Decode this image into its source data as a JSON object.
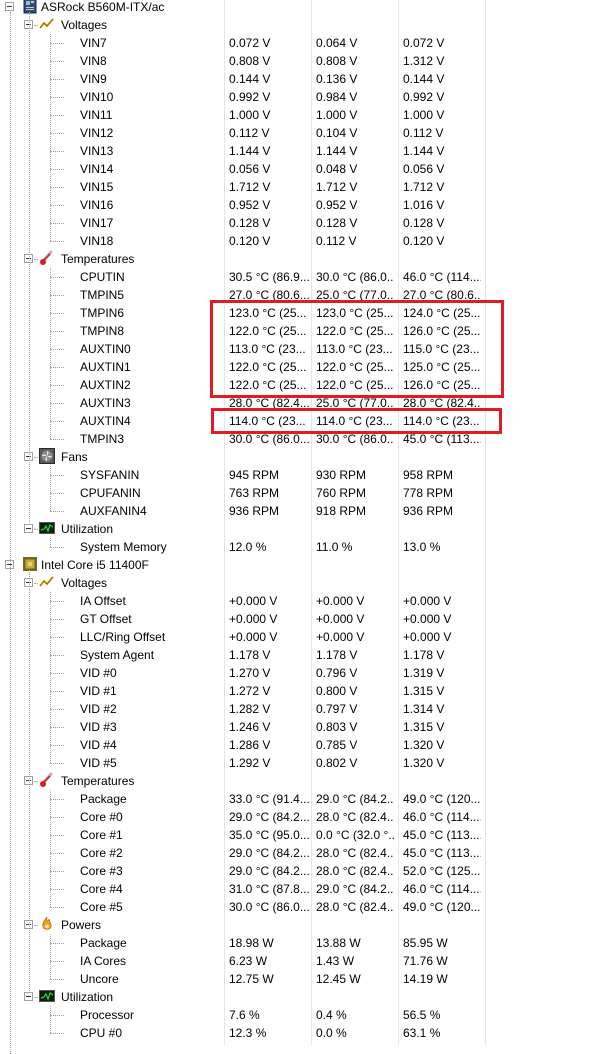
{
  "colors": {
    "highlight": "#e01b24",
    "tree_line": "#a0a0a0"
  },
  "tree": [
    {
      "type": "device",
      "label": "ASRock B560M-ITX/ac",
      "icon": "motherboard-icon",
      "groups": [
        {
          "label": "Voltages",
          "icon": "voltage-icon",
          "sensors": [
            {
              "name": "VIN7",
              "v": [
                "0.072 V",
                "0.064 V",
                "0.072 V"
              ]
            },
            {
              "name": "VIN8",
              "v": [
                "0.808 V",
                "0.808 V",
                "1.312 V"
              ]
            },
            {
              "name": "VIN9",
              "v": [
                "0.144 V",
                "0.136 V",
                "0.144 V"
              ]
            },
            {
              "name": "VIN10",
              "v": [
                "0.992 V",
                "0.984 V",
                "0.992 V"
              ]
            },
            {
              "name": "VIN11",
              "v": [
                "1.000 V",
                "1.000 V",
                "1.000 V"
              ]
            },
            {
              "name": "VIN12",
              "v": [
                "0.112 V",
                "0.104 V",
                "0.112 V"
              ]
            },
            {
              "name": "VIN13",
              "v": [
                "1.144 V",
                "1.144 V",
                "1.144 V"
              ]
            },
            {
              "name": "VIN14",
              "v": [
                "0.056 V",
                "0.048 V",
                "0.056 V"
              ]
            },
            {
              "name": "VIN15",
              "v": [
                "1.712 V",
                "1.712 V",
                "1.712 V"
              ]
            },
            {
              "name": "VIN16",
              "v": [
                "0.952 V",
                "0.952 V",
                "1.016 V"
              ]
            },
            {
              "name": "VIN17",
              "v": [
                "0.128 V",
                "0.128 V",
                "0.128 V"
              ]
            },
            {
              "name": "VIN18",
              "v": [
                "0.120 V",
                "0.112 V",
                "0.120 V"
              ]
            }
          ]
        },
        {
          "label": "Temperatures",
          "icon": "thermometer-icon",
          "sensors": [
            {
              "name": "CPUTIN",
              "v": [
                "30.5 °C  (86.9...",
                "30.0 °C  (86.0...",
                "46.0 °C  (114...."
              ]
            },
            {
              "name": "TMPIN5",
              "v": [
                "27.0 °C  (80.6...",
                "25.0 °C  (77.0...",
                "27.0 °C  (80.6..."
              ]
            },
            {
              "name": "TMPIN6",
              "v": [
                "123.0 °C  (25...",
                "123.0 °C  (25...",
                "124.0 °C  (25..."
              ]
            },
            {
              "name": "TMPIN8",
              "v": [
                "122.0 °C  (25...",
                "122.0 °C  (25...",
                "126.0 °C  (25..."
              ]
            },
            {
              "name": "AUXTIN0",
              "v": [
                "113.0 °C  (23...",
                "113.0 °C  (23...",
                "115.0 °C  (23..."
              ]
            },
            {
              "name": "AUXTIN1",
              "v": [
                "122.0 °C  (25...",
                "122.0 °C  (25...",
                "125.0 °C  (25..."
              ]
            },
            {
              "name": "AUXTIN2",
              "v": [
                "122.0 °C  (25...",
                "122.0 °C  (25...",
                "126.0 °C  (25..."
              ]
            },
            {
              "name": "AUXTIN3",
              "v": [
                "28.0 °C  (82.4...",
                "25.0 °C  (77.0...",
                "28.0 °C  (82.4..."
              ]
            },
            {
              "name": "AUXTIN4",
              "v": [
                "114.0 °C  (23...",
                "114.0 °C  (23...",
                "114.0 °C  (23..."
              ]
            },
            {
              "name": "TMPIN3",
              "v": [
                "30.0 °C  (86.0...",
                "30.0 °C  (86.0...",
                "45.0 °C  (113...."
              ]
            }
          ]
        },
        {
          "label": "Fans",
          "icon": "fan-icon",
          "sensors": [
            {
              "name": "SYSFANIN",
              "v": [
                "945 RPM",
                "930 RPM",
                "958 RPM"
              ]
            },
            {
              "name": "CPUFANIN",
              "v": [
                "763 RPM",
                "760 RPM",
                "778 RPM"
              ]
            },
            {
              "name": "AUXFANIN4",
              "v": [
                "936 RPM",
                "918 RPM",
                "936 RPM"
              ]
            }
          ]
        },
        {
          "label": "Utilization",
          "icon": "utilization-icon",
          "sensors": [
            {
              "name": "System Memory",
              "v": [
                "12.0 %",
                "11.0 %",
                "13.0 %"
              ]
            }
          ]
        }
      ]
    },
    {
      "type": "device",
      "label": "Intel Core i5 11400F",
      "icon": "cpu-icon",
      "groups": [
        {
          "label": "Voltages",
          "icon": "voltage-icon",
          "sensors": [
            {
              "name": "IA Offset",
              "v": [
                "+0.000 V",
                "+0.000 V",
                "+0.000 V"
              ]
            },
            {
              "name": "GT Offset",
              "v": [
                "+0.000 V",
                "+0.000 V",
                "+0.000 V"
              ]
            },
            {
              "name": "LLC/Ring Offset",
              "v": [
                "+0.000 V",
                "+0.000 V",
                "+0.000 V"
              ]
            },
            {
              "name": "System Agent",
              "v": [
                "1.178 V",
                "1.178 V",
                "1.178 V"
              ]
            },
            {
              "name": "VID #0",
              "v": [
                "1.270 V",
                "0.796 V",
                "1.319 V"
              ]
            },
            {
              "name": "VID #1",
              "v": [
                "1.272 V",
                "0.800 V",
                "1.315 V"
              ]
            },
            {
              "name": "VID #2",
              "v": [
                "1.282 V",
                "0.797 V",
                "1.314 V"
              ]
            },
            {
              "name": "VID #3",
              "v": [
                "1.246 V",
                "0.803 V",
                "1.315 V"
              ]
            },
            {
              "name": "VID #4",
              "v": [
                "1.286 V",
                "0.785 V",
                "1.320 V"
              ]
            },
            {
              "name": "VID #5",
              "v": [
                "1.292 V",
                "0.802 V",
                "1.320 V"
              ]
            }
          ]
        },
        {
          "label": "Temperatures",
          "icon": "thermometer-icon",
          "sensors": [
            {
              "name": "Package",
              "v": [
                "33.0 °C  (91.4...",
                "29.0 °C  (84.2...",
                "49.0 °C  (120...."
              ]
            },
            {
              "name": "Core #0",
              "v": [
                "29.0 °C  (84.2...",
                "28.0 °C  (82.4...",
                "46.0 °C  (114...."
              ]
            },
            {
              "name": "Core #1",
              "v": [
                "35.0 °C  (95.0...",
                "0.0 °C  (32.0 °...",
                "45.0 °C  (113...."
              ]
            },
            {
              "name": "Core #2",
              "v": [
                "29.0 °C  (84.2...",
                "28.0 °C  (82.4...",
                "45.0 °C  (113...."
              ]
            },
            {
              "name": "Core #3",
              "v": [
                "29.0 °C  (84.2...",
                "28.0 °C  (82.4...",
                "52.0 °C  (125...."
              ]
            },
            {
              "name": "Core #4",
              "v": [
                "31.0 °C  (87.8...",
                "29.0 °C  (84.2...",
                "46.0 °C  (114...."
              ]
            },
            {
              "name": "Core #5",
              "v": [
                "30.0 °C  (86.0...",
                "28.0 °C  (82.4...",
                "49.0 °C  (120...."
              ]
            }
          ]
        },
        {
          "label": "Powers",
          "icon": "power-icon",
          "sensors": [
            {
              "name": "Package",
              "v": [
                "18.98 W",
                "13.88 W",
                "85.95 W"
              ]
            },
            {
              "name": "IA Cores",
              "v": [
                "6.23 W",
                "1.43 W",
                "71.76 W"
              ]
            },
            {
              "name": "Uncore",
              "v": [
                "12.75 W",
                "12.45 W",
                "14.19 W"
              ]
            }
          ]
        },
        {
          "label": "Utilization",
          "icon": "utilization-icon",
          "sensors": [
            {
              "name": "Processor",
              "v": [
                "7.6 %",
                "0.4 %",
                "56.5 %"
              ]
            },
            {
              "name": "CPU #0",
              "v": [
                "12.3 %",
                "0.0 %",
                "63.1 %"
              ]
            }
          ]
        }
      ]
    }
  ]
}
